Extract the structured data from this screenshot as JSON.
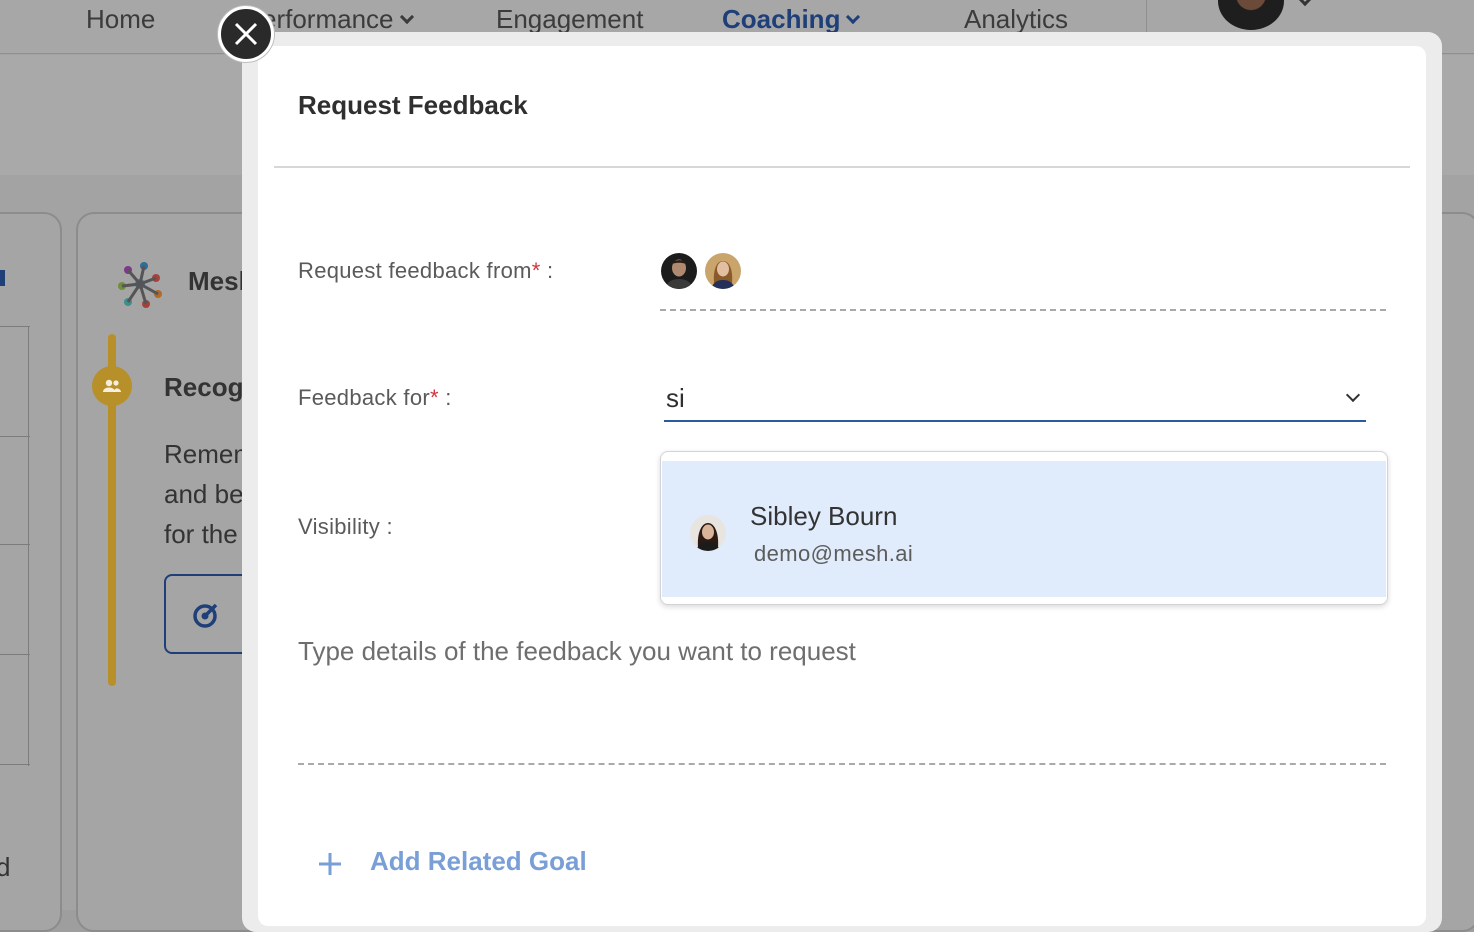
{
  "nav": {
    "items": [
      {
        "label": "Home"
      },
      {
        "label": "erformance"
      },
      {
        "label": "Engagement"
      },
      {
        "label": "Coaching"
      },
      {
        "label": "Analytics"
      }
    ]
  },
  "background": {
    "card_title": "Mesh",
    "section_title": "Recogn",
    "body_lines": [
      "Remem",
      "and be",
      "for the"
    ],
    "left_card_fragment": "d"
  },
  "modal": {
    "title": "Request Feedback",
    "fields": {
      "request_from": {
        "label": "Request feedback from",
        "required_mark": "*",
        "suffix": " :"
      },
      "feedback_for": {
        "label": "Feedback for",
        "required_mark": "*",
        "suffix": " :",
        "value": "si"
      },
      "visibility": {
        "label": "Visibility :"
      }
    },
    "dropdown": {
      "options": [
        {
          "name": "Sibley Bourn",
          "email": "demo@mesh.ai"
        }
      ]
    },
    "details": {
      "placeholder": "Type details of the feedback you want to request"
    },
    "add_goal_label": "Add Related Goal"
  },
  "colors": {
    "accent_blue": "#2c5aa0",
    "link_blue": "#7a9fd6",
    "required_red": "#d0343c",
    "highlight": "#e0ebfb",
    "timeline_gold": "#b8902a"
  },
  "icons": {
    "close": "close-icon",
    "add": "plus-icon",
    "chevron": "chevron-down-icon"
  }
}
